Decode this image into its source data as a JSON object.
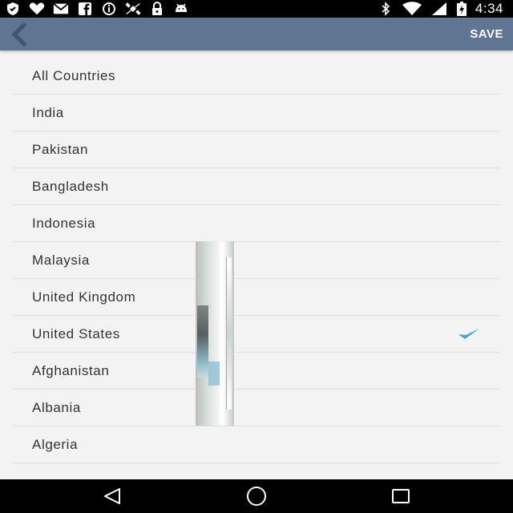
{
  "status_bar": {
    "time": "4:34",
    "icons_left": [
      "shield-icon",
      "heart-icon",
      "mail-icon",
      "facebook-icon",
      "info-icon",
      "satellite-icon",
      "lock-icon",
      "android-icon"
    ],
    "icons_right": [
      "bluetooth-icon",
      "wifi-icon",
      "battery-icon"
    ]
  },
  "app_bar": {
    "back_icon": "chevron-left-icon",
    "save_label": "SAVE",
    "background": "#5f7591"
  },
  "countries": [
    {
      "label": "All Countries",
      "selected": false
    },
    {
      "label": "India",
      "selected": false
    },
    {
      "label": "Pakistan",
      "selected": false
    },
    {
      "label": "Bangladesh",
      "selected": false
    },
    {
      "label": "Indonesia",
      "selected": false
    },
    {
      "label": "Malaysia",
      "selected": false
    },
    {
      "label": "United Kingdom",
      "selected": false
    },
    {
      "label": "United States",
      "selected": true
    },
    {
      "label": "Afghanistan",
      "selected": false
    },
    {
      "label": "Albania",
      "selected": false
    },
    {
      "label": "Algeria",
      "selected": false
    }
  ],
  "colors": {
    "check": "#4aa3d8",
    "list_background": "#f3f3f3",
    "divider": "#dedede"
  },
  "nav_bar": {
    "icons": [
      "back-triangle-icon",
      "home-circle-icon",
      "recents-square-icon"
    ]
  }
}
